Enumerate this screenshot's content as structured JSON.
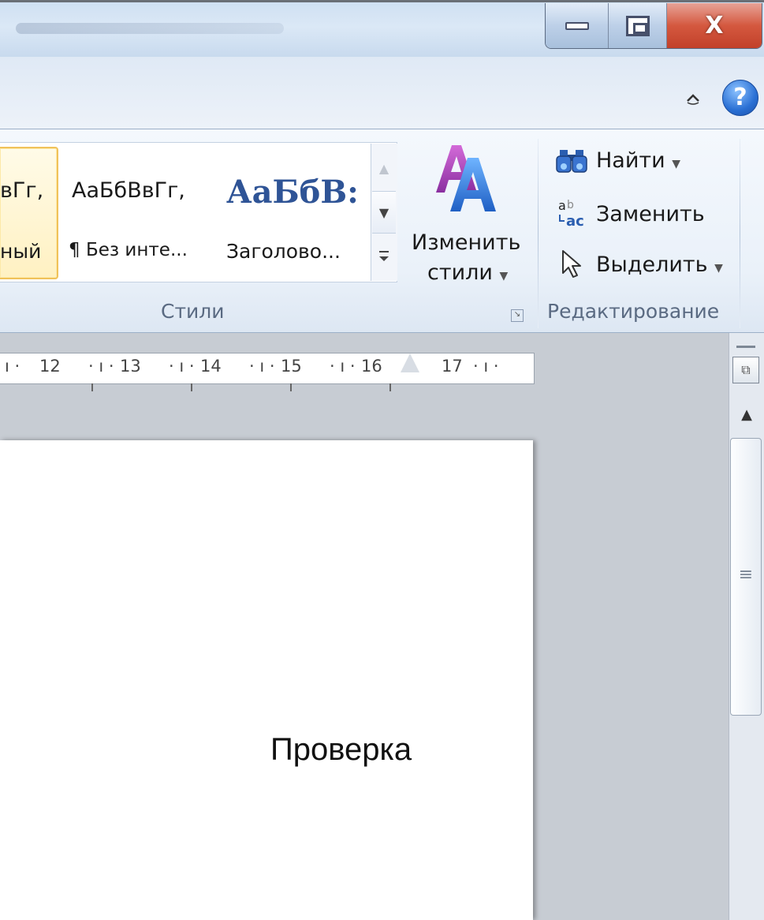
{
  "window": {
    "minimize_icon": "minimize-icon",
    "maximize_icon": "restore-icon",
    "close_glyph": "X"
  },
  "ribbon_controls": {
    "collapse_icon": "^",
    "help_glyph": "?"
  },
  "styles_group": {
    "label": "Стили",
    "items": [
      {
        "preview": "вГг,",
        "caption": "ный",
        "selected": true
      },
      {
        "preview": "АаБбВвГг,",
        "caption": "¶ Без инте...",
        "selected": false
      },
      {
        "preview": "АаБбВ:",
        "caption": "Заголово...",
        "selected": false
      }
    ],
    "change_styles_line1": "Изменить",
    "change_styles_line2": "стили"
  },
  "editing_group": {
    "label": "Редактирование",
    "find": "Найти",
    "replace": "Заменить",
    "select": "Выделить"
  },
  "ruler": {
    "labels": [
      "12",
      "13",
      "14",
      "15",
      "16",
      "17"
    ]
  },
  "document": {
    "text": "Проверка"
  },
  "colors": {
    "accent": "#2f5496",
    "selected_style_border": "#f0c25a",
    "close_button": "#d4583f"
  }
}
